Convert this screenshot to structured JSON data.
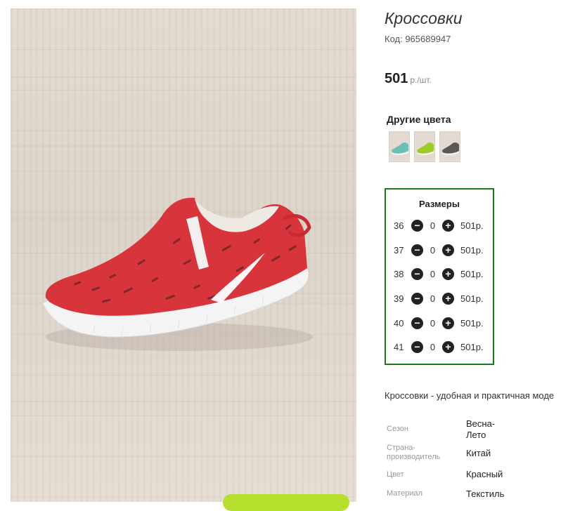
{
  "product": {
    "title": "Кроссовки",
    "code": "Код: 965689947",
    "price_value": "501",
    "price_unit": "р./шт."
  },
  "other_colors": {
    "label": "Другие цвета",
    "swatches": [
      {
        "name": "mint-sneaker",
        "color": "#6bbfb5"
      },
      {
        "name": "green-sneaker",
        "color": "#9ccc2a"
      },
      {
        "name": "grey-sneaker",
        "color": "#5e5757"
      }
    ]
  },
  "sizes": {
    "title": "Размеры",
    "rows": [
      {
        "size": "36",
        "qty": "0",
        "price": "501р."
      },
      {
        "size": "37",
        "qty": "0",
        "price": "501р."
      },
      {
        "size": "38",
        "qty": "0",
        "price": "501р."
      },
      {
        "size": "39",
        "qty": "0",
        "price": "501р."
      },
      {
        "size": "40",
        "qty": "0",
        "price": "501р."
      },
      {
        "size": "41",
        "qty": "0",
        "price": "501р."
      }
    ]
  },
  "description": "Кроссовки - удобная и практичная моде",
  "specs": [
    {
      "label": "Сезон",
      "value": "Весна-Лето"
    },
    {
      "label": "Страна-производитель",
      "value": "Китай"
    },
    {
      "label": "Цвет",
      "value": "Красный"
    },
    {
      "label": "Материал",
      "value": "Текстиль"
    }
  ],
  "colors": {
    "accent_border": "#1b7a1b",
    "shoe_red": "#d8343c",
    "cart_button": "#b6e02d"
  }
}
